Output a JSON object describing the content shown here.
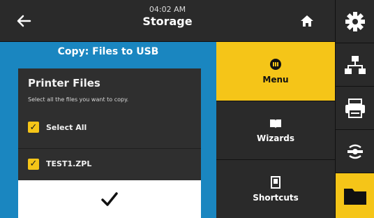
{
  "header": {
    "time": "04:02 AM",
    "title": "Storage",
    "back_icon": "back-arrow-icon",
    "home_icon": "home-icon"
  },
  "copy_panel": {
    "title": "Copy: Files to USB",
    "heading": "Printer Files",
    "subtitle": "Select all the files you want to copy.",
    "select_all_label": "Select All",
    "select_all_checked": true,
    "files": [
      {
        "name": "TEST1.ZPL",
        "checked": true
      }
    ],
    "confirm_icon": "checkmark-icon"
  },
  "nav": {
    "items": [
      {
        "label": "Menu",
        "icon": "menu-icon",
        "active": true
      },
      {
        "label": "Wizards",
        "icon": "book-icon",
        "active": false
      },
      {
        "label": "Shortcuts",
        "icon": "bookmark-icon",
        "active": false
      }
    ]
  },
  "side_icons": [
    "settings-gear-icon",
    "network-icon",
    "printer-icon",
    "connection-icon",
    "folder-icon"
  ],
  "colors": {
    "accent": "#f5c518",
    "panel_blue": "#1a86c0",
    "dark": "#2a2a2a"
  }
}
